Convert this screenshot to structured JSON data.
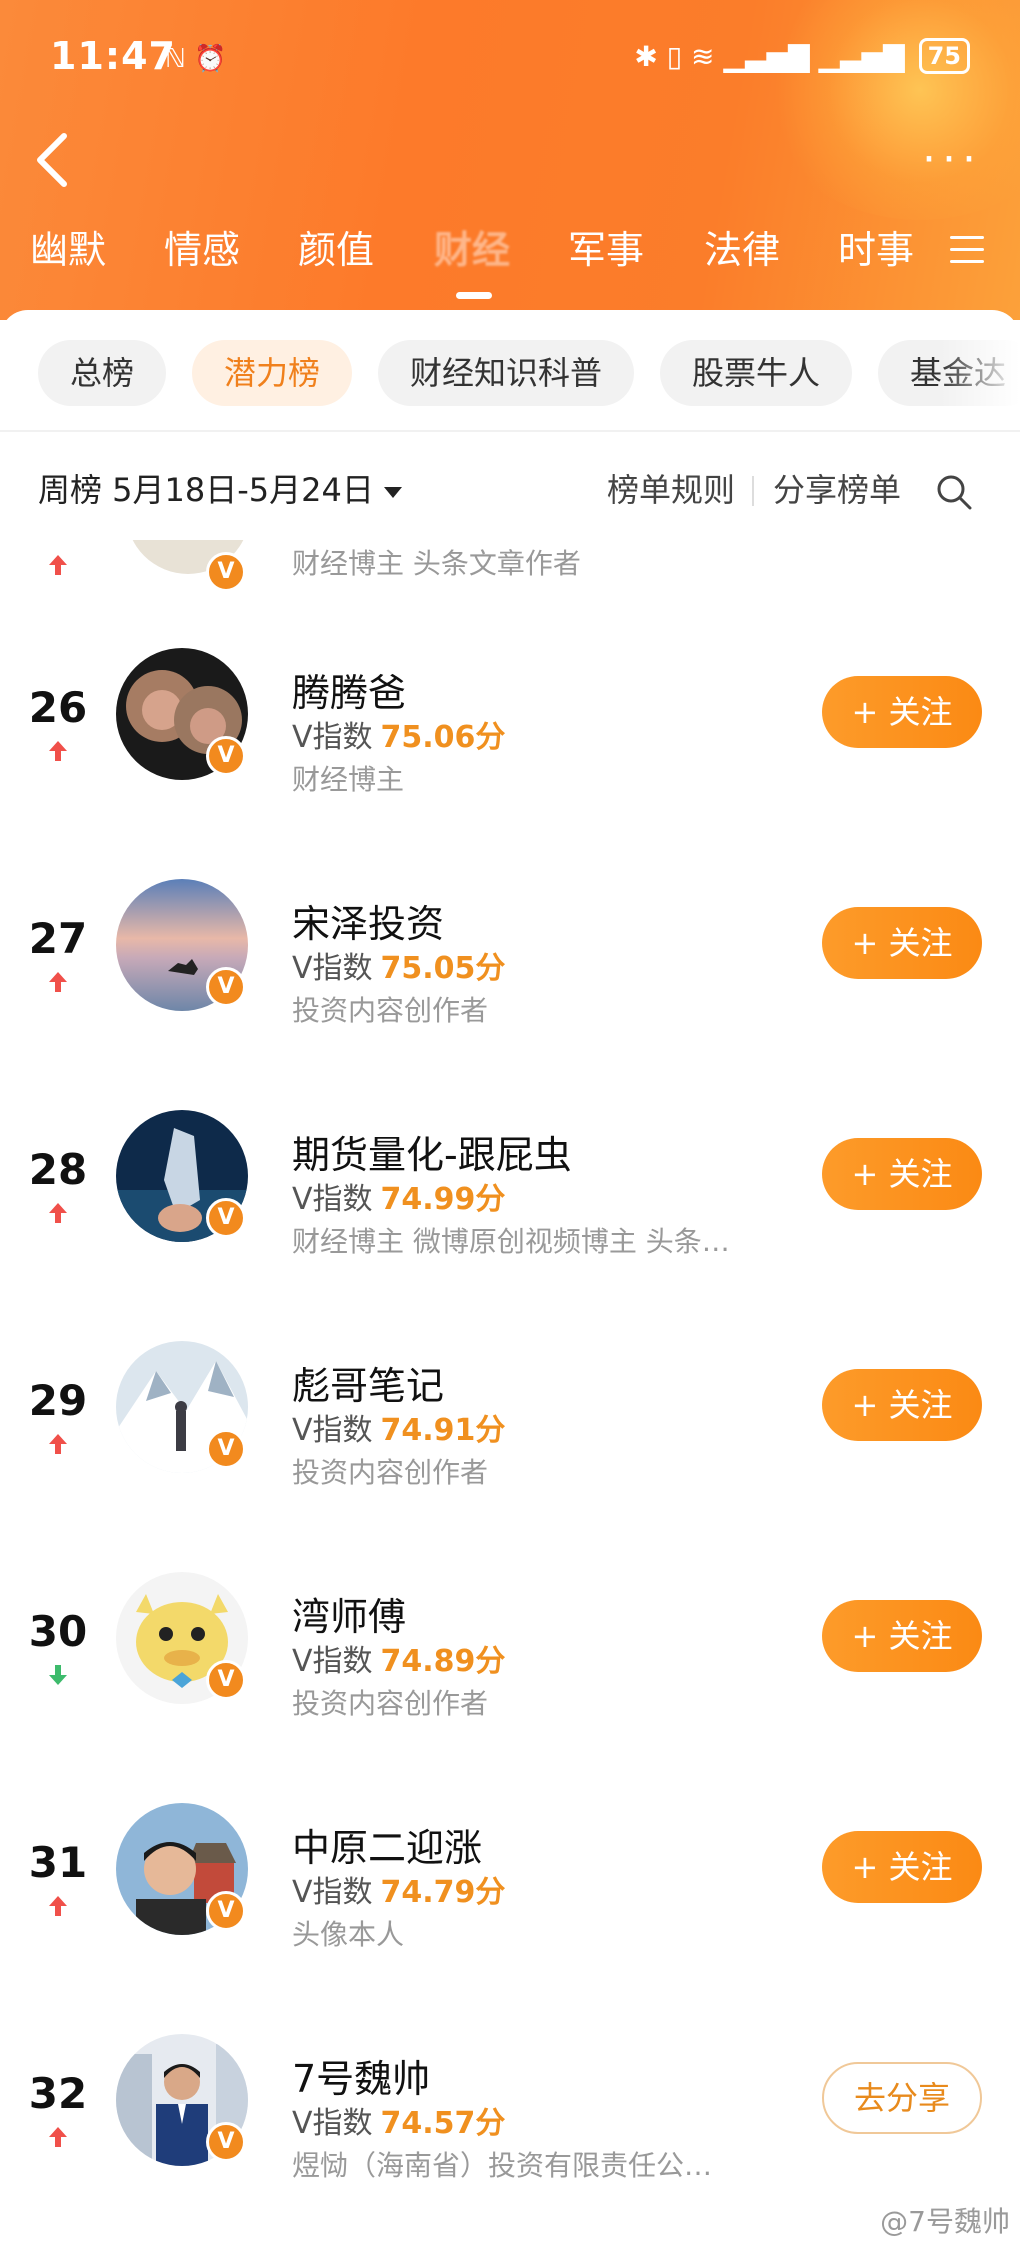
{
  "status_bar": {
    "time": "11:47",
    "battery": "75",
    "left_icons": "ℕ ⏰",
    "right_icons": "✱ ▯ ≋ ▁▃▅▇ ▁▃▅▇"
  },
  "nav": {
    "back_icon": "chevron-left-icon",
    "more_icon": "···"
  },
  "category_tabs": [
    {
      "label": "幽默"
    },
    {
      "label": "情感"
    },
    {
      "label": "颜值"
    },
    {
      "label": "财经"
    },
    {
      "label": "军事"
    },
    {
      "label": "法律"
    },
    {
      "label": "时事"
    }
  ],
  "filter_chips": [
    {
      "label": "总榜"
    },
    {
      "label": "潜力榜"
    },
    {
      "label": "财经知识科普"
    },
    {
      "label": "股票牛人"
    },
    {
      "label": "基金达"
    }
  ],
  "subbar": {
    "week_range": "周榜 5月18日-5月24日",
    "rules_label": "榜单规则",
    "share_label": "分享榜单"
  },
  "partial_row": {
    "tags": "财经博主 头条文章作者"
  },
  "rank_rows": [
    {
      "rank": "26",
      "trend": "up",
      "name": "腾腾爸",
      "v_label": "V指数",
      "score": "75.06分",
      "tags": "财经博主",
      "action": "+ 关注"
    },
    {
      "rank": "27",
      "trend": "up",
      "name": "宋泽投资",
      "v_label": "V指数",
      "score": "75.05分",
      "tags": "投资内容创作者",
      "action": "+ 关注"
    },
    {
      "rank": "28",
      "trend": "up",
      "name": "期货量化-跟屁虫",
      "v_label": "V指数",
      "score": "74.99分",
      "tags": "财经博主 微博原创视频博主 头条…",
      "action": "+ 关注"
    },
    {
      "rank": "29",
      "trend": "up",
      "name": "彪哥笔记",
      "v_label": "V指数",
      "score": "74.91分",
      "tags": "投资内容创作者",
      "action": "+ 关注"
    },
    {
      "rank": "30",
      "trend": "down",
      "name": "湾师傅",
      "v_label": "V指数",
      "score": "74.89分",
      "tags": "投资内容创作者",
      "action": "+ 关注"
    },
    {
      "rank": "31",
      "trend": "up",
      "name": "中原二迎涨",
      "v_label": "V指数",
      "score": "74.79分",
      "tags": "头像本人",
      "action": "+ 关注"
    },
    {
      "rank": "32",
      "trend": "up",
      "name": "7号魏帅",
      "v_label": "V指数",
      "score": "74.57分",
      "tags": "煜恸（海南省）投资有限责任公…",
      "action": "去分享"
    }
  ],
  "watermark": "@7号魏帅",
  "colors": {
    "accent_orange": "#fb8a14",
    "score_orange": "#f0901f",
    "trend_up": "#f0504a",
    "trend_down": "#3dbb6c"
  }
}
